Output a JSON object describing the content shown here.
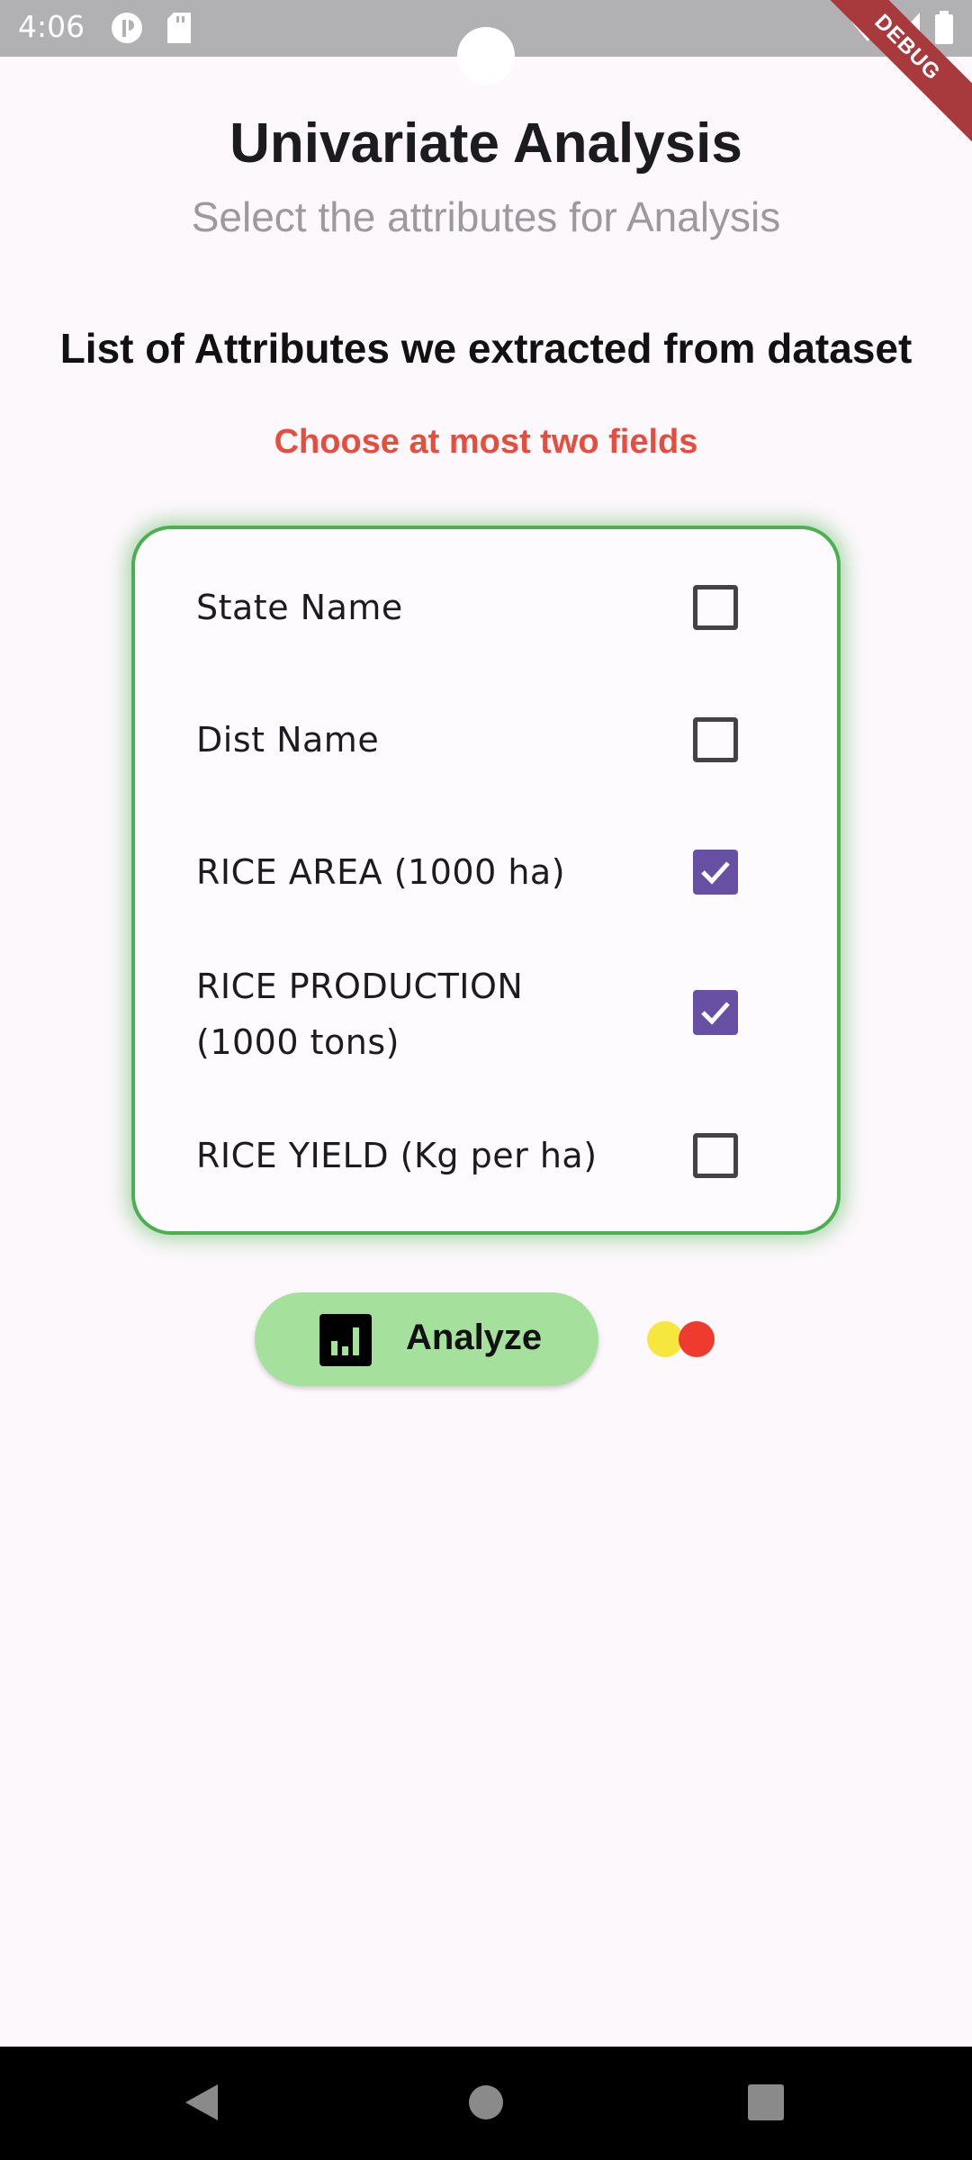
{
  "status_bar": {
    "time": "4:06",
    "icons": [
      "p-icon",
      "sd-card-icon",
      "wifi-icon",
      "signal-icon",
      "battery-icon"
    ],
    "debug_banner": "DEBUG"
  },
  "header": {
    "title": "Univariate Analysis",
    "subtitle": "Select the attributes for Analysis"
  },
  "main": {
    "section_heading": "List of Attributes we extracted from dataset",
    "instruction": "Choose at most two fields",
    "instruction_color": "#e84c3d",
    "card_border_color": "#4caf50",
    "checkbox_checked_color": "#6750a4",
    "attributes": [
      {
        "label": "State Name",
        "checked": false
      },
      {
        "label": "Dist Name",
        "checked": false
      },
      {
        "label": "RICE AREA (1000 ha)",
        "checked": true
      },
      {
        "label": "RICE PRODUCTION (1000 tons)",
        "checked": true
      },
      {
        "label": "RICE YIELD (Kg per ha)",
        "checked": false
      }
    ]
  },
  "actions": {
    "analyze_label": "Analyze",
    "analyze_icon": "bar-chart-icon",
    "analyze_color": "#a5e09d"
  },
  "nav_bar": {
    "buttons": [
      "back-icon",
      "home-icon",
      "recents-icon"
    ]
  }
}
